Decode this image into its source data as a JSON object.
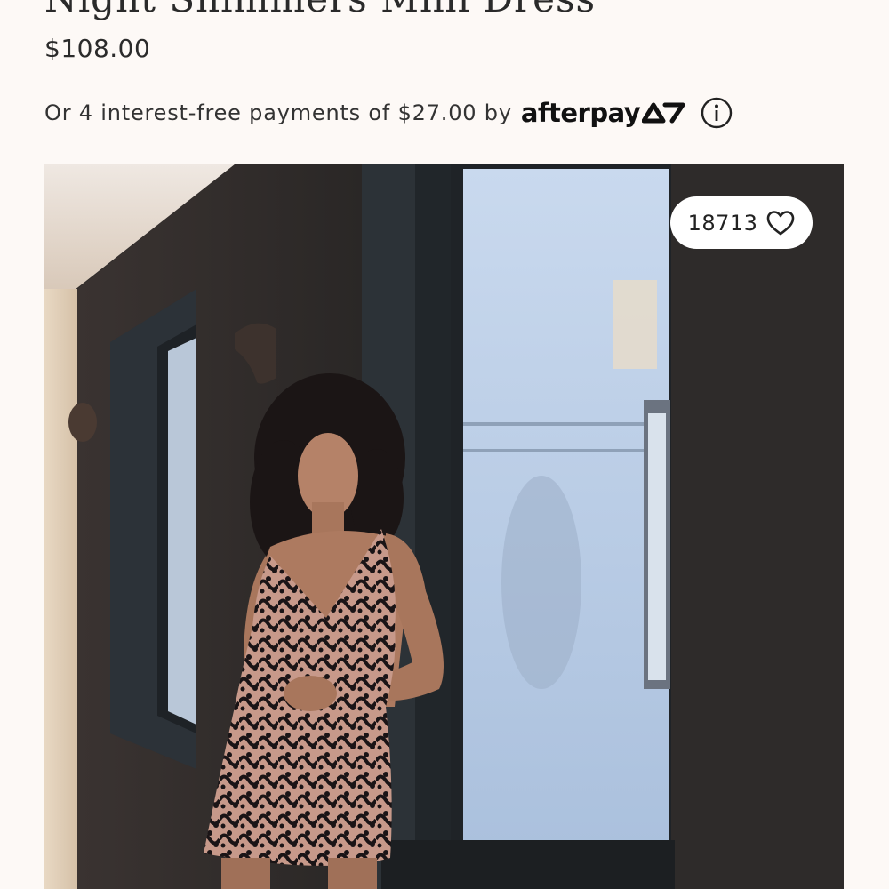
{
  "product": {
    "title": "Night Shimmers Mini Dress",
    "price": "$108.00"
  },
  "afterpay": {
    "text": "Or 4 interest-free payments of $27.00 by",
    "brand": "afterpay"
  },
  "likes": {
    "count": "18713"
  },
  "icons": {
    "info": "info-circle-icon",
    "heart": "heart-outline-icon",
    "afterpay_mark": "afterpay-arrows-icon"
  },
  "colors": {
    "background": "#fdf9f6",
    "text": "#222222",
    "badge_background": "#ffffff"
  }
}
